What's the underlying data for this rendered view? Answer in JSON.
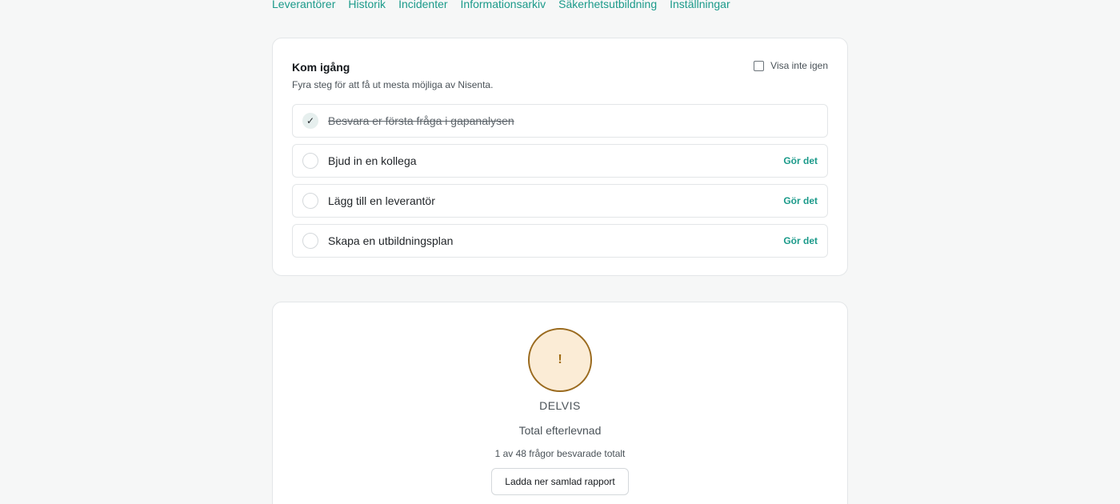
{
  "nav": {
    "links": [
      "Leverantörer",
      "Historik",
      "Incidenter",
      "Informationsarkiv",
      "Säkerhetsutbildning",
      "Inställningar"
    ]
  },
  "getting_started": {
    "title": "Kom igång",
    "subtitle": "Fyra steg för att få ut mesta möjliga av Nisenta.",
    "dismiss_label": "Visa inte igen",
    "steps": [
      {
        "label": "Besvara er första fråga i gapanalysen",
        "done": true,
        "check": "✓"
      },
      {
        "label": "Bjud in en kollega",
        "done": false,
        "action": "Gör det"
      },
      {
        "label": "Lägg till en leverantör",
        "done": false,
        "action": "Gör det"
      },
      {
        "label": "Skapa en utbildningsplan",
        "done": false,
        "action": "Gör det"
      }
    ]
  },
  "compliance": {
    "icon": "exclamation-icon",
    "icon_glyph": "!",
    "status": "DELVIS",
    "caption": "Total efterlevnad",
    "count": "1 av 48 frågor besvarade totalt",
    "download_label": "Ladda ner samlad rapport",
    "colors": {
      "ring": "#9a6a1e",
      "fill": "#fbecd6"
    }
  }
}
